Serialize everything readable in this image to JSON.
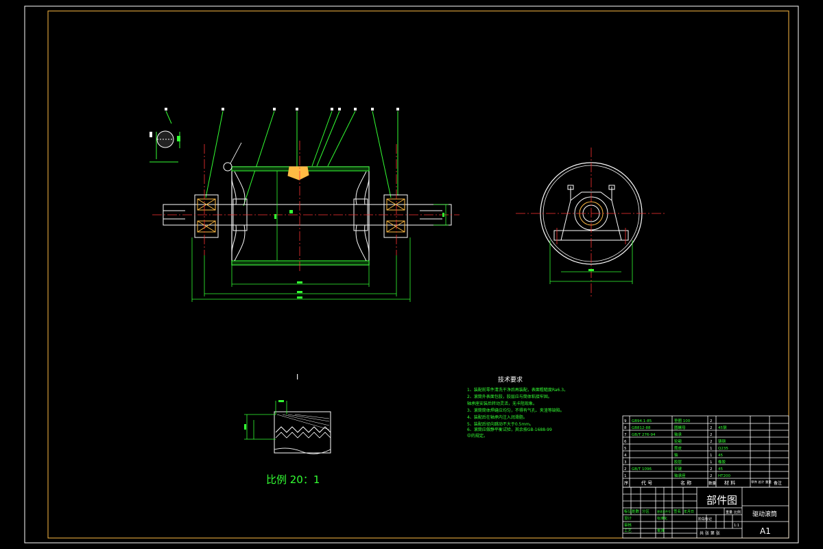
{
  "drawing": {
    "detail_label": "I",
    "scale_note": "比例 20：1",
    "tech_title": "技术要求",
    "tech_notes": [
      "1、装配前零件清洗干净后再装配，表面粗糙度Ra6.3。",
      "2、滚筒外表面包胶，胶层应与筒体粘接牢固。",
      "   轴承座安装后转动灵活，无卡阻现象。",
      "3、滚筒筒体焊缝应均匀，不得有气孔、夹渣等缺陷。",
      "4、装配后在轴承内注入润滑脂。",
      "5、装配后径向跳动不大于0.5mm。",
      "6、滚筒应做静平衡试验，其余按GB-1688-99",
      "中的规定。"
    ],
    "bom_header": {
      "seq": "序",
      "code": "代 号",
      "name": "名 称",
      "qty": "数量",
      "material": "材 料",
      "weight": "单件 总计 重量",
      "note": "备注"
    },
    "bom_rows": [
      {
        "seq": "9",
        "code": "GB94.1-85",
        "name": "垫圈 100",
        "qty": "2",
        "material": ""
      },
      {
        "seq": "8",
        "code": "GB812-88",
        "name": "圆螺母",
        "qty": "2",
        "material": "45钢"
      },
      {
        "seq": "7",
        "code": "GB/T 276-94",
        "name": "轴承",
        "qty": "2",
        "material": ""
      },
      {
        "seq": "6",
        "code": "",
        "name": "轮毂",
        "qty": "2",
        "material": "铸钢"
      },
      {
        "seq": "5",
        "code": "",
        "name": "筒皮",
        "qty": "1",
        "material": "Q235"
      },
      {
        "seq": "4",
        "code": "",
        "name": "轴",
        "qty": "1",
        "material": "45"
      },
      {
        "seq": "3",
        "code": "",
        "name": "胶层",
        "qty": "1",
        "material": "橡胶"
      },
      {
        "seq": "2",
        "code": "GB/T 1096",
        "name": "平键",
        "qty": "2",
        "material": "45"
      },
      {
        "seq": "1",
        "code": "",
        "name": "轴承座",
        "qty": "2",
        "material": "HT200"
      }
    ],
    "title_block": {
      "drawing_type": "部件图",
      "part_name": "驱动滚筒",
      "sheet_size": "A1",
      "scale_value": "1:1",
      "labels": {
        "marking": "标记",
        "count": "处数",
        "zone": "分区",
        "change_doc": "更改文件号",
        "signature": "签名",
        "date": "年月日",
        "design": "设计",
        "standardize": "标准化",
        "review": "审核",
        "process": "工艺",
        "approve": "批准",
        "stage": "阶段标记",
        "mass": "重量",
        "scale": "比例",
        "sheets": "共 张 第 张"
      }
    }
  }
}
